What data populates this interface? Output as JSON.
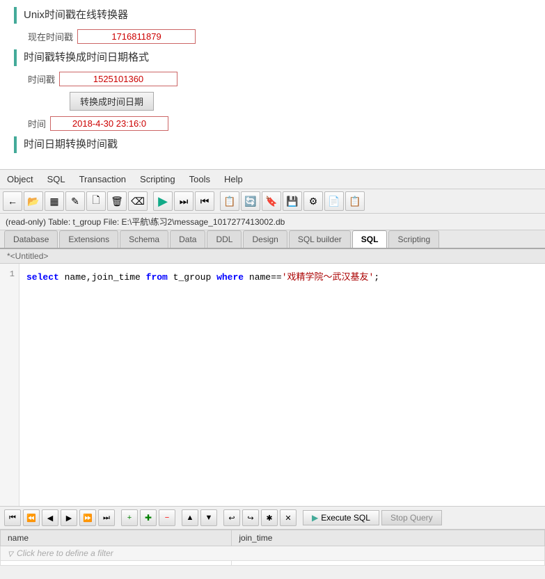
{
  "top_panel": {
    "section1_title": "Unix时间戳在线转换器",
    "current_time_label": "现在时间戳",
    "current_time_value": "1716811879",
    "section2_title": "时间戳转换成时间日期格式",
    "timestamp_label": "时间戳",
    "timestamp_value": "1525101360",
    "convert_btn_label": "转换成时间日期",
    "time_label": "时间",
    "time_value": "2018-4-30 23:16:0",
    "section3_title": "时间日期转换时间戳"
  },
  "menubar": {
    "items": [
      "Object",
      "SQL",
      "Transaction",
      "Scripting",
      "Tools",
      "Help"
    ]
  },
  "toolbar": {
    "buttons": [
      "⬅",
      "📂",
      "▦",
      "✏",
      "🖹",
      "🗑",
      "⌫",
      "▶",
      "⏭",
      "⏮",
      "📋",
      "🔄",
      "🔖",
      "💾",
      "⚙",
      "📄",
      "📋2"
    ]
  },
  "statusbar": {
    "text": "(read-only)  Table: t_group   File: E:\\平航\\练习2\\message_1017277413002.db"
  },
  "tabs": {
    "items": [
      "Database",
      "Extensions",
      "Schema",
      "Data",
      "DDL",
      "Design",
      "SQL builder",
      "SQL",
      "Scripting"
    ],
    "active_index": 7
  },
  "editor": {
    "untitled_label": "*<Untitled>",
    "line_number": "1",
    "code_line": "select name,join_time from t_group where name=='戏精学院～武汉基友';"
  },
  "bottom_toolbar": {
    "nav_buttons": [
      "⏮",
      "⏪",
      "◀",
      "▶",
      "⏩",
      "⏭",
      "+",
      "✚",
      "−",
      "▲",
      "▼",
      "↩",
      "↪",
      "✱",
      "✕"
    ],
    "execute_label": "Execute SQL",
    "stop_label": "Stop Query"
  },
  "results": {
    "columns": [
      "name",
      "join_time"
    ],
    "filter_placeholder": "Click here to define a filter",
    "rows": []
  }
}
